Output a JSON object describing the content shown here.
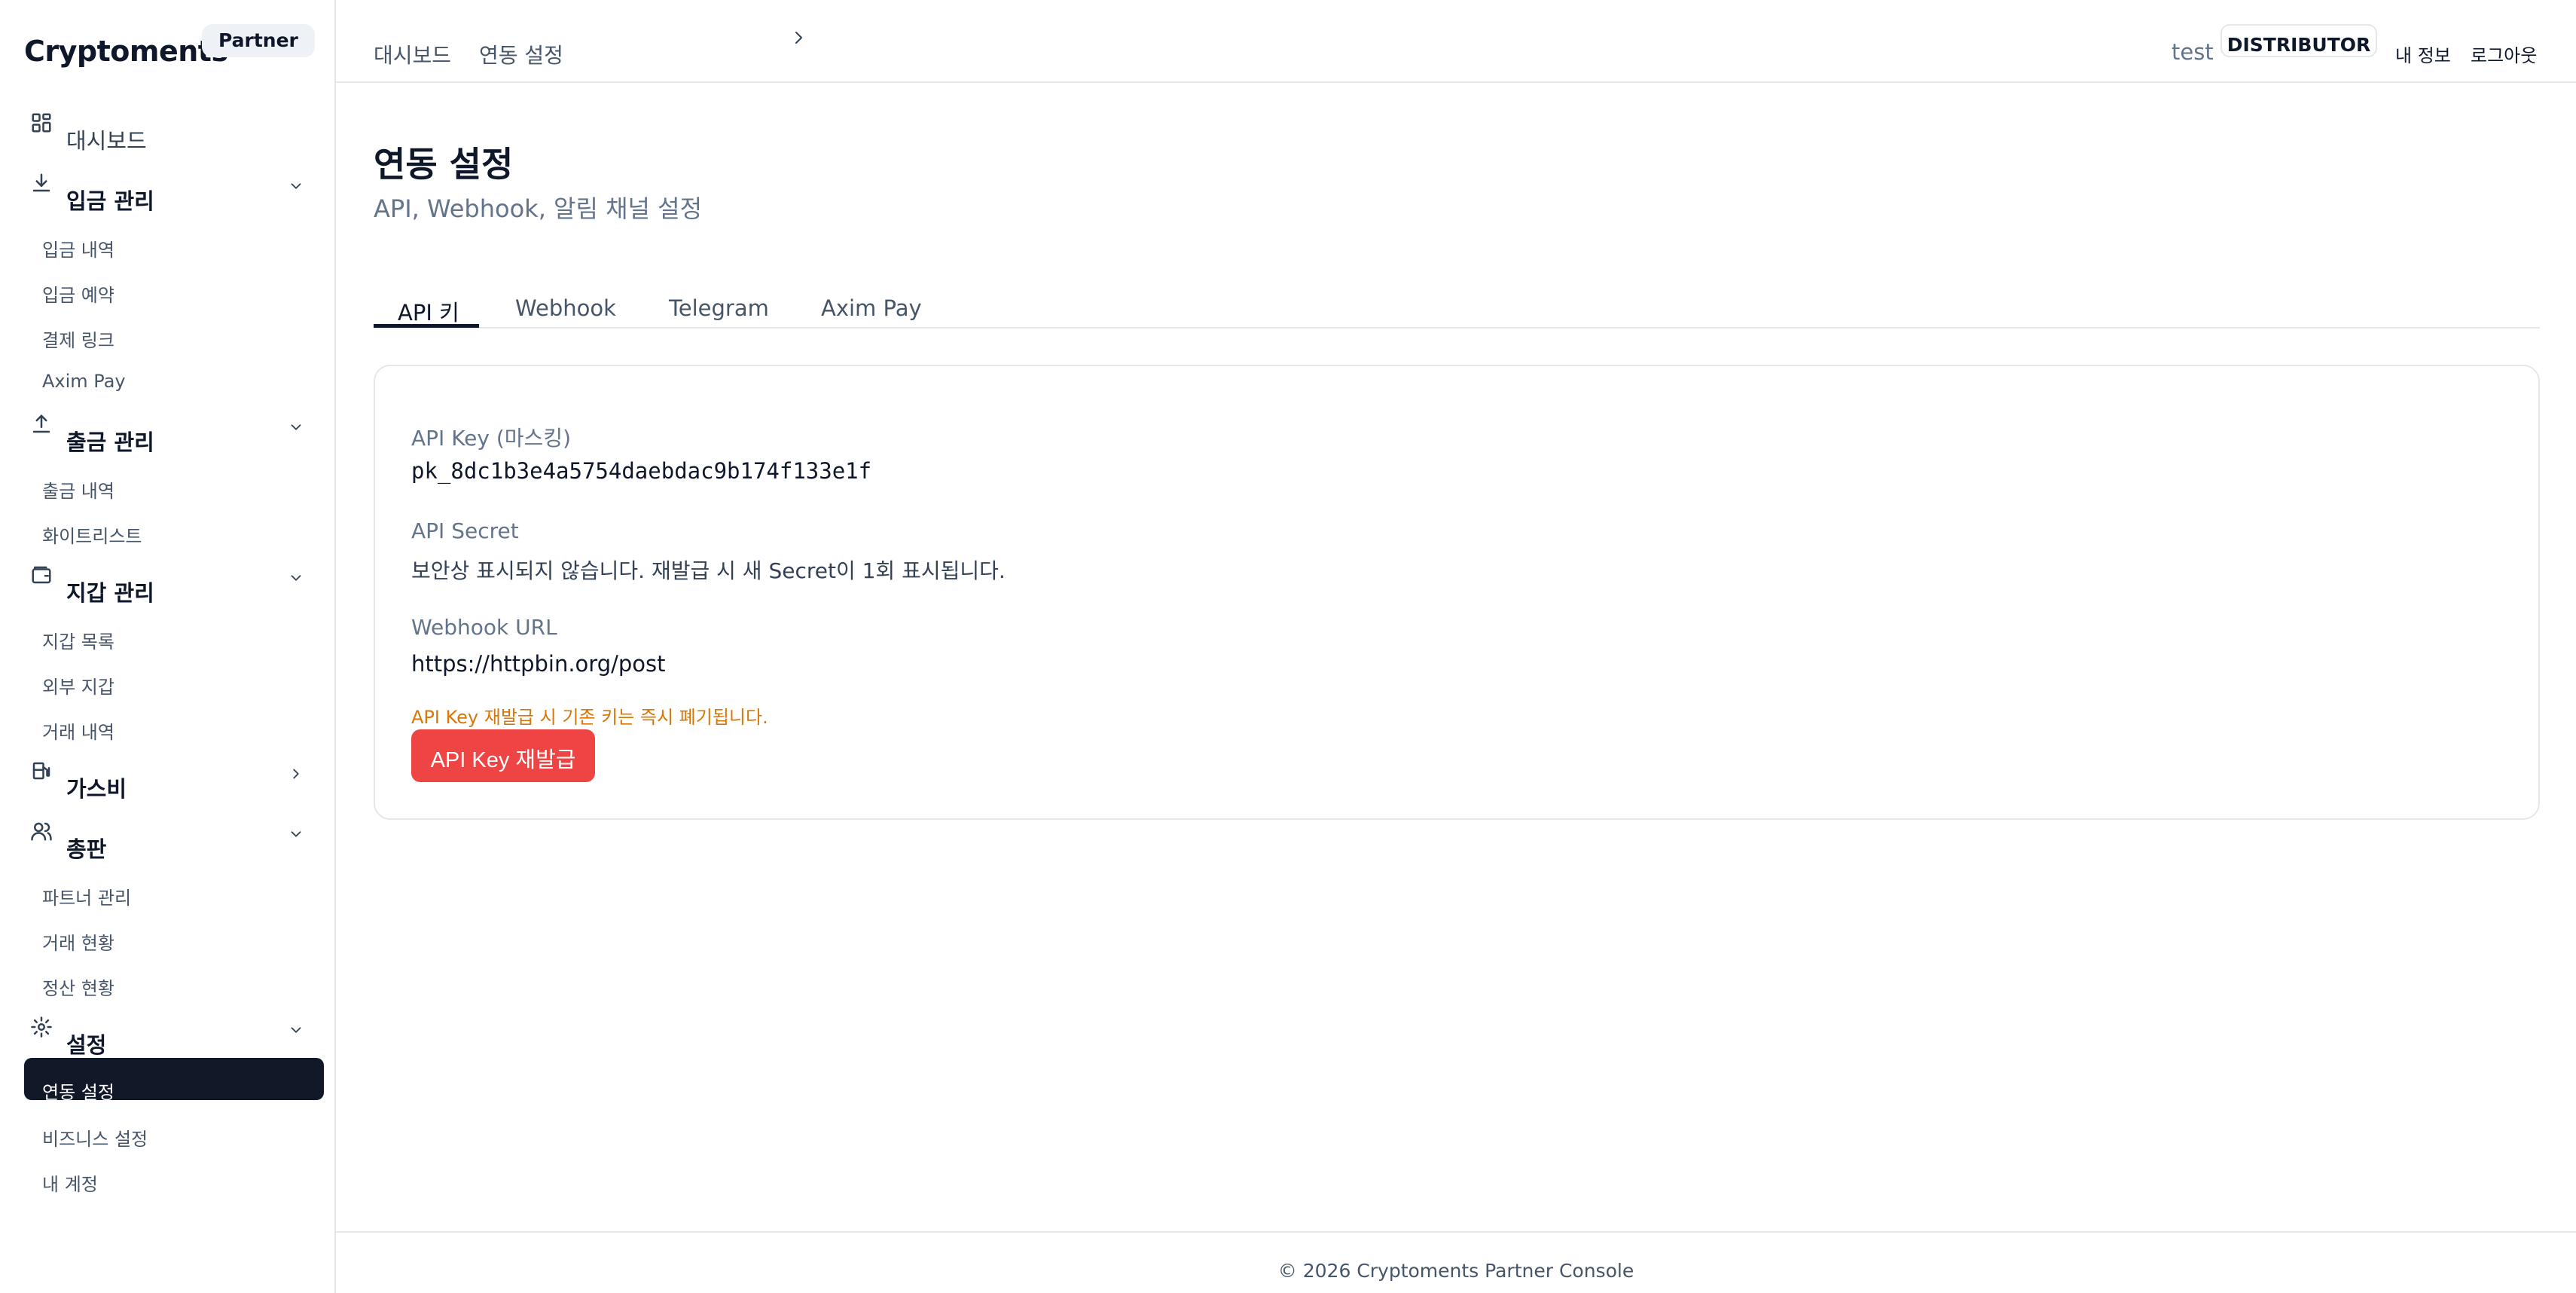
{
  "brand": {
    "name": "Cryptoments",
    "badge": "Partner"
  },
  "sidebar": {
    "dashboard": {
      "label": "대시보드",
      "icon": "grid-icon"
    },
    "deposit": {
      "label": "입금 관리",
      "icon": "download-icon",
      "items": [
        "입금 내역",
        "입금 예약",
        "결제 링크",
        "Axim Pay"
      ]
    },
    "withdraw": {
      "label": "출금 관리",
      "icon": "upload-icon",
      "items": [
        "출금 내역",
        "화이트리스트"
      ]
    },
    "wallet": {
      "label": "지갑 관리",
      "icon": "wallet-icon",
      "items": [
        "지갑 목록",
        "외부 지갑",
        "거래 내역"
      ]
    },
    "gas": {
      "label": "가스비",
      "icon": "fuel-icon"
    },
    "distributor": {
      "label": "총판",
      "icon": "users-icon",
      "items": [
        "파트너 관리",
        "거래 현황",
        "정산 현황"
      ]
    },
    "settings": {
      "label": "설정",
      "icon": "gear-icon",
      "items": [
        "연동 설정",
        "비즈니스 설정",
        "내 계정"
      ],
      "active": "연동 설정"
    }
  },
  "header": {
    "breadcrumb": [
      "대시보드",
      "연동 설정"
    ],
    "user": "test",
    "role": "DISTRIBUTOR",
    "my_info": "내 정보",
    "logout": "로그아웃"
  },
  "page": {
    "title": "연동 설정",
    "subtitle": "API, Webhook, 알림 채널 설정"
  },
  "tabs": [
    "API 키",
    "Webhook",
    "Telegram",
    "Axim Pay"
  ],
  "active_tab": "API 키",
  "api_card": {
    "api_key_label": "API Key (마스킹)",
    "api_key_value": "pk_8dc1b3e4a5754daebdac9b174f133e1f",
    "api_secret_label": "API Secret",
    "api_secret_note": "보안상 표시되지 않습니다. 재발급 시 새 Secret이 1회 표시됩니다.",
    "webhook_label": "Webhook URL",
    "webhook_value": "https://httpbin.org/post",
    "warning": "API Key 재발급 시 기존 키는 즉시 폐기됩니다.",
    "reissue_button": "API Key 재발급"
  },
  "footer": "© 2026 Cryptoments Partner Console",
  "colors": {
    "primary": "#0f172a",
    "danger": "#ef4444",
    "warning": "#d97706",
    "muted": "#64748b"
  }
}
